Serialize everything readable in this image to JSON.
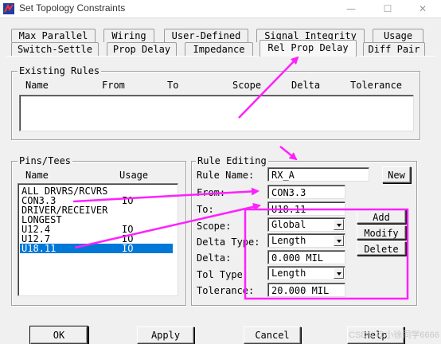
{
  "window": {
    "title": "Set Topology Constraints",
    "minimize": "—",
    "maximize": "☐",
    "close": "✕"
  },
  "tabs": {
    "row1": [
      "Max Parallel",
      "Wiring",
      "User-Defined",
      "Signal Integrity",
      "Usage"
    ],
    "row2": [
      "Switch-Settle",
      "Prop Delay",
      "Impedance",
      "Rel Prop Delay",
      "Diff Pair"
    ],
    "active": "Rel Prop Delay"
  },
  "existing_rules": {
    "title": "Existing Rules",
    "columns": [
      "Name",
      "From",
      "To",
      "Scope",
      "Delta",
      "Tolerance"
    ],
    "rows": []
  },
  "pins_tees": {
    "title": "Pins/Tees",
    "columns": [
      "Name",
      "Usage"
    ],
    "items": [
      {
        "name": "ALL DRVRS/RCVRS",
        "usage": ""
      },
      {
        "name": "CON3.3",
        "usage": "IO"
      },
      {
        "name": "DRIVER/RECEIVER",
        "usage": ""
      },
      {
        "name": "LONGEST",
        "usage": ""
      },
      {
        "name": "U12.4",
        "usage": "IO"
      },
      {
        "name": "U12.7",
        "usage": "IO"
      },
      {
        "name": "U18.11",
        "usage": "IO"
      }
    ],
    "selected": "U18.11"
  },
  "rule_editing": {
    "title": "Rule Editing",
    "rule_name_label": "Rule Name:",
    "rule_name": "RX_A",
    "new_button": "New",
    "from_label": "From:",
    "from_value": "CON3.3",
    "to_label": "To:",
    "to_value": "U18.11",
    "scope_label": "Scope:",
    "scope_value": "Global",
    "delta_type_label": "Delta Type:",
    "delta_type_value": "Length",
    "delta_label": "Delta:",
    "delta_value": "0.000 MIL",
    "tol_type_label": "Tol Type:",
    "tol_type_value": "Length",
    "tolerance_label": "Tolerance:",
    "tolerance_value": "20.000 MIL",
    "add_button": "Add",
    "modify_button": "Modify",
    "delete_button": "Delete"
  },
  "footer": {
    "ok": "OK",
    "apply": "Apply",
    "cancel": "Cancel",
    "help": "Help"
  },
  "watermark": "CSDN @小徐同学6666",
  "colors": {
    "annotation": "#ff20ff",
    "selection": "#0078d7",
    "dialog_bg": "#f0f0f0"
  }
}
